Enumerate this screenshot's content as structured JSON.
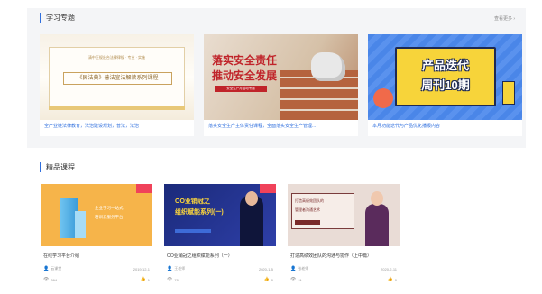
{
  "topics": {
    "title": "学习专题",
    "more": "查看更多 ›",
    "cards": [
      {
        "small": "清中正规出台法律律规 · 专业 · 实施",
        "main": "《民法典》普法宣法解读系列课程",
        "caption": "全产业链法律教育，法治建设规划，普法，法治"
      },
      {
        "line1": "落实安全责任",
        "line2": "推动安全发展",
        "sub": "安全生产月活动专题",
        "caption": "落实安全生产主体责任课程，全面落实安全生产管理..."
      },
      {
        "line1": "产品迭代",
        "line2": "周刊10期",
        "caption": "本月功能迭代与产品优化播报内容"
      }
    ]
  },
  "courses": {
    "title": "精品课程",
    "items": [
      {
        "img_text1": "企业学习一站式",
        "img_text2": "培训云服务平台",
        "title": "在线学习平台介绍",
        "author": "云课堂",
        "date": "2019-12-1",
        "views": "364",
        "likes": "1"
      },
      {
        "img_text1": "OO业销冠之",
        "img_text2": "组织赋能系列(一)",
        "title": "OO业销冠之组织赋能系列（一）",
        "author": "王老师",
        "date": "2020-1-5",
        "views": "70",
        "likes": "0"
      },
      {
        "img_text1": "打造高绩效团队的",
        "img_text2": "管理者沟通艺术",
        "title": "打造高绩效团队的沟通与协作（上中篇）",
        "author": "张老师",
        "date": "2020-2-11",
        "views": "11",
        "likes": "0"
      }
    ]
  }
}
